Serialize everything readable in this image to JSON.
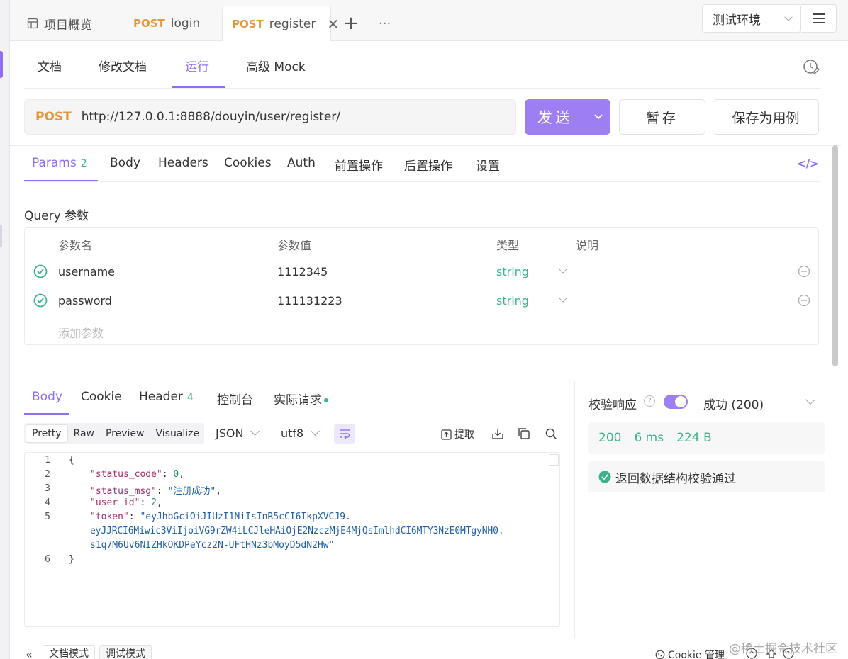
{
  "tabs": [
    {
      "icon": "overview-icon",
      "method": "",
      "label": "项目概览"
    },
    {
      "method": "POST",
      "label": "login"
    },
    {
      "method": "POST",
      "label": "register"
    }
  ],
  "env": {
    "selected": "测试环境"
  },
  "subtabs": [
    "文档",
    "修改文档",
    "运行",
    "高级 Mock"
  ],
  "request": {
    "method": "POST",
    "url": "http://127.0.0.1:8888/douyin/user/register/",
    "send_label": "发送",
    "save_label": "暂存",
    "save_case_label": "保存为用例"
  },
  "req_tabs": {
    "params": "Params",
    "params_count": "2",
    "others": [
      "Body",
      "Headers",
      "Cookies",
      "Auth",
      "前置操作",
      "后置操作",
      "设置"
    ]
  },
  "query": {
    "title": "Query 参数",
    "headers": [
      "参数名",
      "参数值",
      "类型",
      "说明"
    ],
    "rows": [
      {
        "name": "username",
        "value": "1112345",
        "type": "string",
        "desc": ""
      },
      {
        "name": "password",
        "value": "111131223",
        "type": "string",
        "desc": ""
      }
    ],
    "add_placeholder": "添加参数"
  },
  "resp_tabs": {
    "body": "Body",
    "cookie": "Cookie",
    "header": "Header",
    "header_count": "4",
    "console": "控制台",
    "actual": "实际请求"
  },
  "view": {
    "modes": [
      "Pretty",
      "Raw",
      "Preview",
      "Visualize"
    ],
    "format": "JSON",
    "encoding": "utf8",
    "extract": "提取"
  },
  "code": {
    "line_numbers": [
      "1",
      "2",
      "3",
      "4",
      "5",
      "",
      "",
      "6"
    ],
    "status_code_key": "\"status_code\"",
    "status_code_val": "0",
    "status_msg_key": "\"status_msg\"",
    "status_msg_val": "\"注册成功\"",
    "user_id_key": "\"user_id\"",
    "user_id_val": "2",
    "token_key": "\"token\"",
    "token_line1": "\"eyJhbGciOiJIUzI1NiIsInR5cCI6IkpXVCJ9.",
    "token_line2": "eyJJRCI6Miwic3ViIjoiVG9rZW4iLCJleHAiOjE2NzczMjE4MjQsImlhdCI6MTY3NzE0MTgyNH0.",
    "token_line3": "s1q7M6Uv6NIZHkOKDPeYcz2N-UFtHNz3bMoyD5dN2Hw\""
  },
  "verify": {
    "label": "校验响应",
    "help": "?",
    "status": "成功 (200)",
    "code": "200",
    "time": "6 ms",
    "size": "224 B",
    "schema_msg": "返回数据结构校验通过"
  },
  "footer": {
    "doc_mode": "文档模式",
    "debug_mode": "调试模式",
    "cookie_mgr": "Cookie 管理",
    "watermark": "@稀土掘金技术社区"
  },
  "colors": {
    "accent": "#8f6ff0",
    "method": "#e6973a",
    "success": "#3cb48a"
  }
}
